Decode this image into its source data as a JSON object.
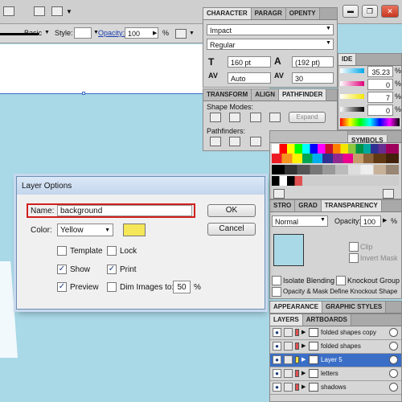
{
  "toolbar": {
    "stroke_style": "Basic",
    "style_label": "Style:",
    "opacity_label": "Opacity:",
    "opacity_value": "100",
    "opacity_unit": "%"
  },
  "character_panel": {
    "tabs": [
      "CHARACTER",
      "PARAGR",
      "OPENTY"
    ],
    "font_family": "Impact",
    "font_style": "Regular",
    "font_size": "160 pt",
    "leading": "(192 pt)",
    "kerning": "Auto",
    "tracking": "30"
  },
  "pathfinder_panel": {
    "tabs": [
      "TRANSFORM",
      "ALIGN",
      "PATHFINDER"
    ],
    "shape_modes_label": "Shape Modes:",
    "expand_label": "Expand",
    "pathfinders_label": "Pathfinders:"
  },
  "color_panel": {
    "tab": "IDE",
    "values": [
      "35.23",
      "0",
      "7",
      "0"
    ],
    "unit": "%"
  },
  "swatches_panel": {
    "tab": "SYMBOLS"
  },
  "transparency_panel": {
    "tabs": [
      "STRO",
      "GRAD",
      "TRANSPARENCY"
    ],
    "blend_mode": "Normal",
    "opacity_label": "Opacity:",
    "opacity_value": "100",
    "opacity_unit": "%",
    "clip_label": "Clip",
    "invert_mask_label": "Invert Mask",
    "isolate_blending_label": "Isolate Blending",
    "knockout_group_label": "Knockout Group",
    "opacity_mask_label": "Opacity & Mask Define Knockout Shape"
  },
  "appearance_bar": {
    "tabs": [
      "APPEARANCE",
      "GRAPHIC STYLES"
    ]
  },
  "layers_panel": {
    "tabs": [
      "LAYERS",
      "ARTBOARDS"
    ],
    "layers": [
      {
        "name": "folded shapes copy",
        "color": "#e05050"
      },
      {
        "name": "folded shapes",
        "color": "#e05050"
      },
      {
        "name": "Layer 5",
        "color": "#f0e040"
      },
      {
        "name": "letters",
        "color": "#e05050"
      },
      {
        "name": "shadows",
        "color": "#e05050"
      }
    ]
  },
  "dialog": {
    "title": "Layer Options",
    "name_label": "Name:",
    "name_value": "background",
    "color_label": "Color:",
    "color_value": "Yellow",
    "color_swatch": "#f5e65a",
    "ok_label": "OK",
    "cancel_label": "Cancel",
    "template_label": "Template",
    "lock_label": "Lock",
    "show_label": "Show",
    "print_label": "Print",
    "preview_label": "Preview",
    "dim_images_label": "Dim Images to:",
    "dim_value": "50",
    "dim_unit": "%",
    "checks": {
      "template": false,
      "lock": false,
      "show": true,
      "print": true,
      "preview": true,
      "dim": false
    }
  },
  "window_controls": {
    "minimize": "▬",
    "restore": "❐",
    "close": "✕"
  },
  "colors": {
    "canvas": "#a9d8e6",
    "highlight_border": "#d0201c",
    "selection": "#3a6ec7"
  }
}
